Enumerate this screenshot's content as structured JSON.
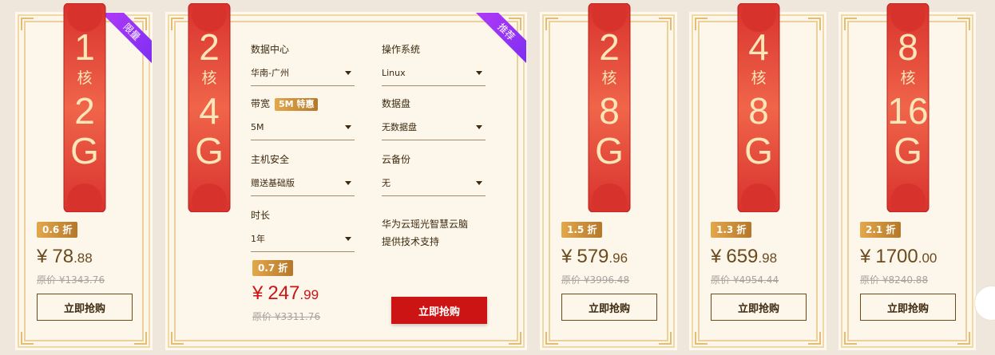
{
  "cards": [
    {
      "cores": "1",
      "core_unit": "核",
      "mem": "2",
      "mem_unit": "G",
      "tag": "限量",
      "discount": "0.6 折",
      "price_int": "78",
      "price_dec": ".88",
      "currency": "¥",
      "orig": "原价 ¥1343.76",
      "buy": "立即抢购"
    },
    {
      "cores": "2",
      "core_unit": "核",
      "mem": "4",
      "mem_unit": "G",
      "tag": "推荐",
      "discount": "0.7 折",
      "price_int": "247",
      "price_dec": ".99",
      "currency": "¥",
      "orig": "原价 ¥3311.76",
      "buy": "立即抢购",
      "fields": {
        "datacenter_label": "数据中心",
        "datacenter_value": "华南-广州",
        "os_label": "操作系统",
        "os_value": "Linux",
        "bandwidth_label": "带宽",
        "bandwidth_badge": "5M 特惠",
        "bandwidth_value": "5M",
        "disk_label": "数据盘",
        "disk_value": "无数据盘",
        "security_label": "主机安全",
        "security_value": "赠送基础版",
        "backup_label": "云备份",
        "backup_value": "无",
        "duration_label": "时长",
        "duration_value": "1年"
      },
      "support_line1": "华为云瑶光智慧云脑",
      "support_line2": "提供技术支持"
    },
    {
      "cores": "2",
      "core_unit": "核",
      "mem": "8",
      "mem_unit": "G",
      "discount": "1.5 折",
      "price_int": "579",
      "price_dec": ".96",
      "currency": "¥",
      "orig": "原价 ¥3996.48",
      "buy": "立即抢购"
    },
    {
      "cores": "4",
      "core_unit": "核",
      "mem": "8",
      "mem_unit": "G",
      "discount": "1.3 折",
      "price_int": "659",
      "price_dec": ".98",
      "currency": "¥",
      "orig": "原价 ¥4954.44",
      "buy": "立即抢购"
    },
    {
      "cores": "8",
      "core_unit": "核",
      "mem": "16",
      "mem_unit": "G",
      "discount": "2.1 折",
      "price_int": "1700",
      "price_dec": ".00",
      "currency": "¥",
      "orig": "原价 ¥8240.88",
      "buy": "立即抢购"
    }
  ],
  "colors": {
    "banner_red": "#d8322d",
    "banner_light": "#f0654a",
    "accent_gold": "#c48b3a",
    "price_red": "#cc1414",
    "ribbon_purple": "#9b35f4"
  }
}
